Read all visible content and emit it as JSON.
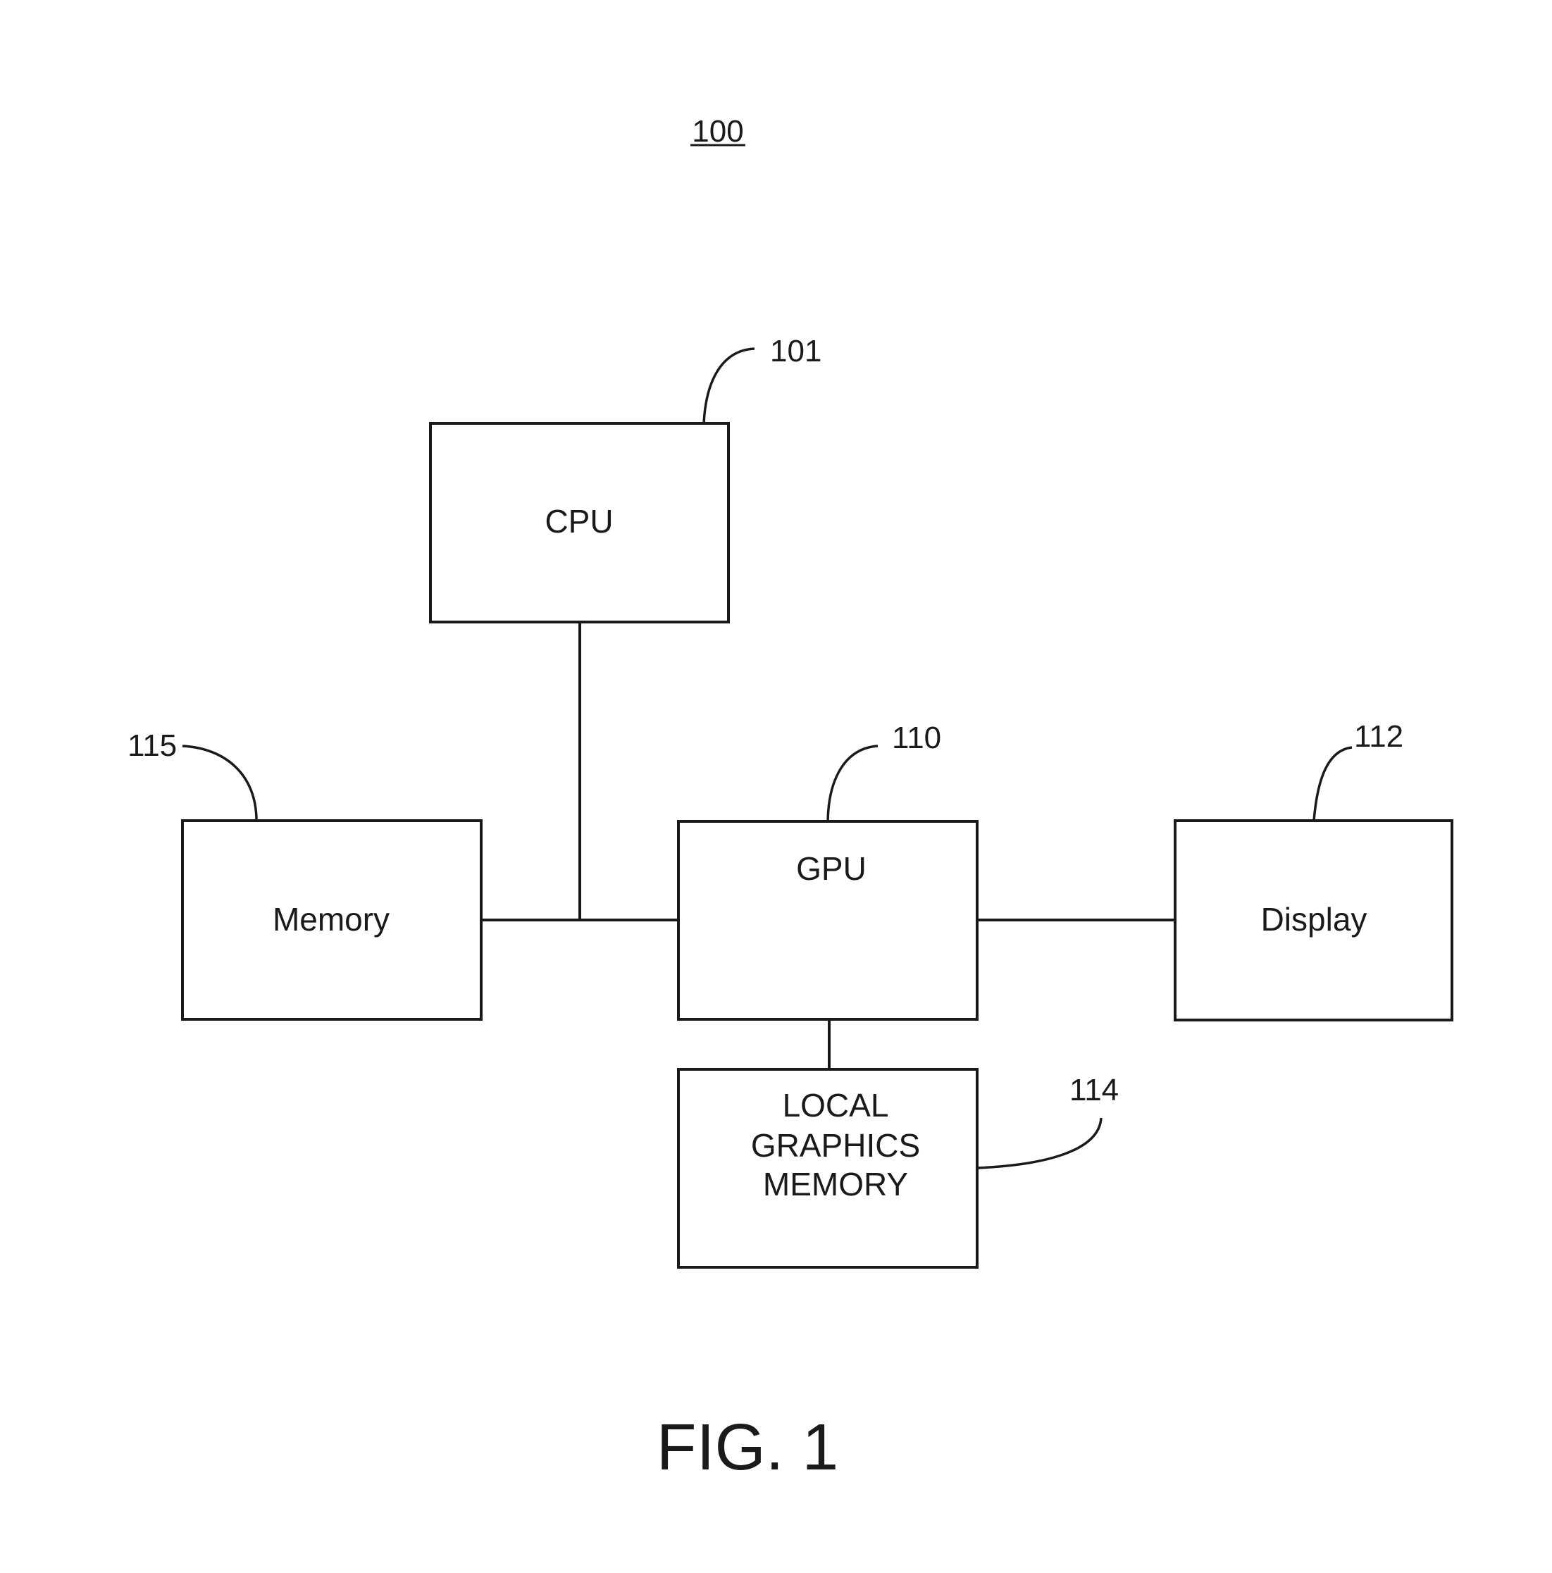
{
  "figure": {
    "number_label": "100",
    "caption": "FIG. 1"
  },
  "blocks": {
    "cpu": {
      "label": "CPU",
      "ref": "101"
    },
    "memory": {
      "label": "Memory",
      "ref": "115"
    },
    "gpu": {
      "label": "GPU",
      "ref": "110"
    },
    "display": {
      "label": "Display",
      "ref": "112"
    },
    "local_graphics_memory": {
      "label_lines": [
        "LOCAL",
        "GRAPHICS",
        "MEMORY"
      ],
      "ref": "114"
    }
  },
  "connections": [
    {
      "from": "cpu",
      "to": "bus"
    },
    {
      "from": "memory",
      "to": "gpu"
    },
    {
      "from": "gpu",
      "to": "display"
    },
    {
      "from": "gpu",
      "to": "local_graphics_memory"
    }
  ]
}
